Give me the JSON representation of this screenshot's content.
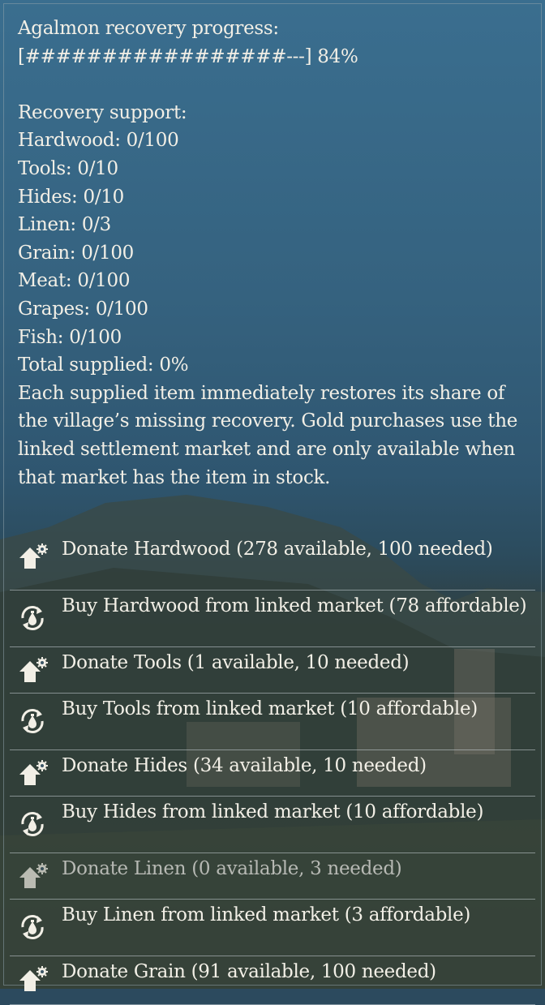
{
  "progress": {
    "title": "Agalmon recovery progress:",
    "bar": "[#################---] 84%",
    "percent": 84
  },
  "support": {
    "heading": "Recovery support:",
    "items": [
      "Hardwood: 0/100",
      "Tools: 0/10",
      "Hides: 0/10",
      "Linen: 0/3",
      "Grain: 0/100",
      "Meat: 0/100",
      "Grapes: 0/100",
      "Fish: 0/100"
    ],
    "total": "Total supplied: 0%",
    "note": "Each supplied item immediately restores its share of the village’s missing recovery. Gold purchases use the linked settlement market and are only available when that market has the item in stock."
  },
  "options": [
    {
      "label": "Donate Hardwood (278 available, 100 needed)",
      "icon": "donate-icon",
      "enabled": true
    },
    {
      "label": "Buy Hardwood from linked market (78 affordable)",
      "icon": "trade-icon",
      "enabled": true
    },
    {
      "label": "Donate Tools (1 available, 10 needed)",
      "icon": "donate-icon",
      "enabled": true
    },
    {
      "label": "Buy Tools from linked market (10 affordable)",
      "icon": "trade-icon",
      "enabled": true
    },
    {
      "label": "Donate Hides (34 available, 10 needed)",
      "icon": "donate-icon",
      "enabled": true
    },
    {
      "label": "Buy Hides from linked market (10 affordable)",
      "icon": "trade-icon",
      "enabled": true
    },
    {
      "label": "Donate Linen (0 available, 3 needed)",
      "icon": "donate-icon",
      "enabled": false
    },
    {
      "label": "Buy Linen from linked market (3 affordable)",
      "icon": "trade-icon",
      "enabled": true
    },
    {
      "label": "Donate Grain (91 available, 100 needed)",
      "icon": "donate-icon",
      "enabled": true
    }
  ]
}
